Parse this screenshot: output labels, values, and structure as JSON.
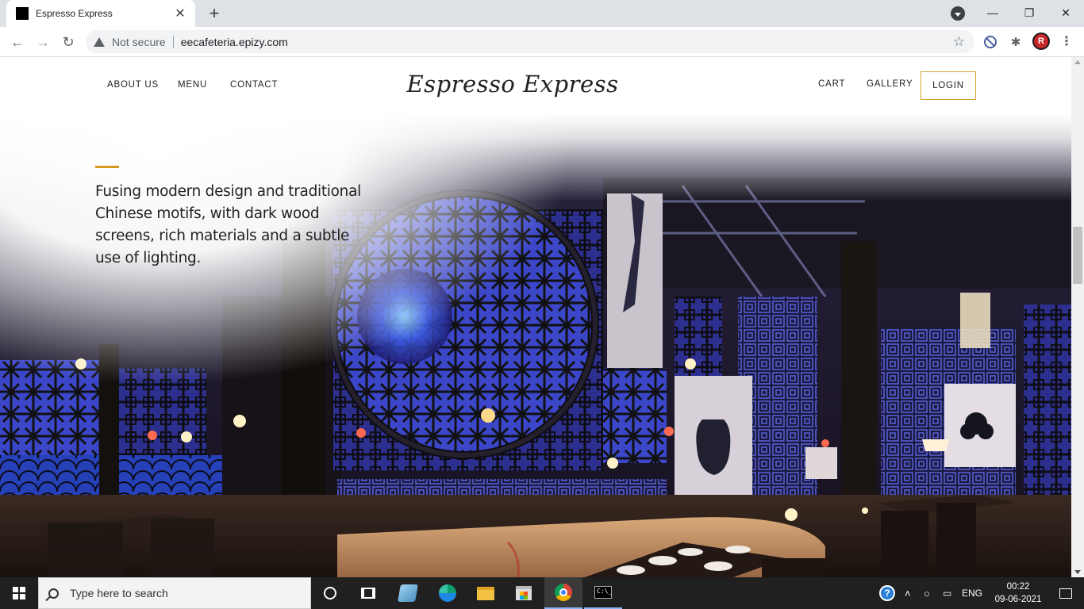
{
  "browser": {
    "tab_title": "Espresso Express",
    "security_label": "Not secure",
    "url": "eecafeteria.epizy.com",
    "profile_initial": "R"
  },
  "site": {
    "brand": "Espresso Express",
    "nav_left": [
      "ABOUT US",
      "MENU",
      "CONTACT"
    ],
    "nav_right": [
      "CART",
      "GALLERY"
    ],
    "login_label": "LOGIN",
    "accent_color": "#d49a1f"
  },
  "hero": {
    "text": "Fusing modern design and traditional Chinese motifs, with dark wood screens, rich materials and a subtle use of lighting."
  },
  "taskbar": {
    "search_placeholder": "Type here to search",
    "language": "ENG",
    "time": "00:22",
    "date": "09-06-2021",
    "apps": [
      "cortana-icon",
      "task-view-icon",
      "app-icon",
      "edge-icon",
      "file-explorer-icon",
      "store-icon",
      "chrome-icon",
      "terminal-icon"
    ]
  }
}
